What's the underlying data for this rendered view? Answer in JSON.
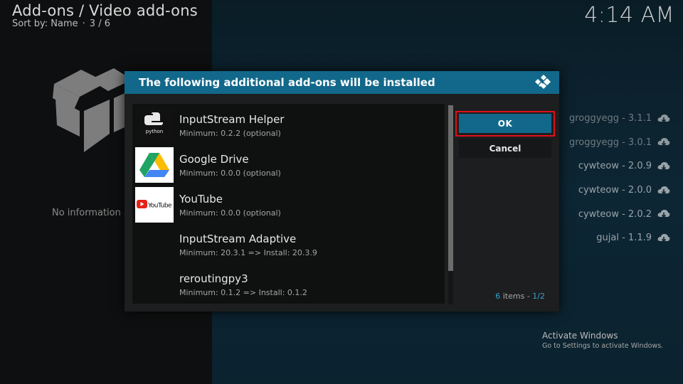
{
  "header": {
    "title": "Add-ons / Video add-ons",
    "sort_label": "Sort by: Name",
    "separator": "·",
    "position": "3 / 6"
  },
  "clock": "4:14 AM",
  "left_panel": {
    "no_info_text": "No information a"
  },
  "versions": [
    {
      "label": "groggyegg - 3.1.1",
      "dim": true
    },
    {
      "label": "groggyegg - 3.0.1",
      "dim": true
    },
    {
      "label": "cywteow - 2.0.9",
      "dim": false
    },
    {
      "label": "cywteow - 2.0.0",
      "dim": false
    },
    {
      "label": "cywteow - 2.0.2",
      "dim": false
    },
    {
      "label": "gujal - 1.1.9",
      "dim": false
    }
  ],
  "dialog": {
    "title": "The following additional add-ons will be installed",
    "ok_label": "OK",
    "cancel_label": "Cancel",
    "items_count": "6",
    "items_word": " items - ",
    "page": "1/2",
    "items": [
      {
        "name": "InputStream Helper",
        "detail": "Minimum: 0.2.2 (optional)",
        "thumb": "python-icon"
      },
      {
        "name": "Google Drive",
        "detail": "Minimum: 0.0.0 (optional)",
        "thumb": "google-drive-icon"
      },
      {
        "name": "YouTube",
        "detail": "Minimum: 0.0.0 (optional)",
        "thumb": "youtube-icon"
      },
      {
        "name": "InputStream Adaptive",
        "detail": "Minimum: 20.3.1 => Install: 20.3.9",
        "thumb": ""
      },
      {
        "name": "reroutingpy3",
        "detail": "Minimum: 0.1.2 => Install: 0.1.2",
        "thumb": ""
      }
    ]
  },
  "python_thumb_text": "python",
  "youtube_thumb_text": "YouTube",
  "watermark": {
    "line1": "Activate Windows",
    "line2": "Go to Settings to activate Windows."
  },
  "colors": {
    "accent": "#12688a",
    "highlight_outline": "#e0101a",
    "count_accent": "#36a2d4"
  }
}
